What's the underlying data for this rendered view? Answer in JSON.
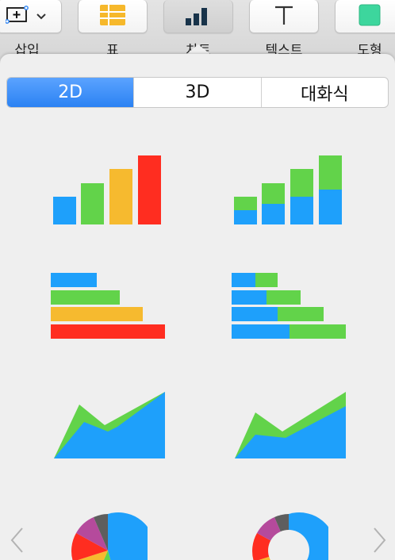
{
  "toolbar": {
    "items": [
      {
        "label": "삽입",
        "icon": "insert-icon"
      },
      {
        "label": "표",
        "icon": "table-icon"
      },
      {
        "label": "차트",
        "icon": "chart-icon"
      },
      {
        "label": "텍스트",
        "icon": "text-icon"
      },
      {
        "label": "도형",
        "icon": "shape-icon"
      }
    ],
    "active": "차트"
  },
  "popover": {
    "tabs": [
      "2D",
      "3D",
      "대화식"
    ],
    "selected_tab": "2D",
    "chart_types": [
      {
        "name": "column"
      },
      {
        "name": "stacked-column"
      },
      {
        "name": "bar"
      },
      {
        "name": "stacked-bar"
      },
      {
        "name": "area"
      },
      {
        "name": "stacked-area"
      },
      {
        "name": "pie"
      },
      {
        "name": "donut"
      }
    ]
  },
  "colors": {
    "blue": "#1ea0fb",
    "green": "#62d34a",
    "yellow": "#f6ba2f",
    "red": "#ff2d20",
    "purple": "#b54a9c",
    "gray": "#5e5e5e",
    "orange": "#f78c1e",
    "selected_tab": "#2b82f3",
    "icon_dark": "#18334a",
    "shape_green": "#3dd69d"
  }
}
